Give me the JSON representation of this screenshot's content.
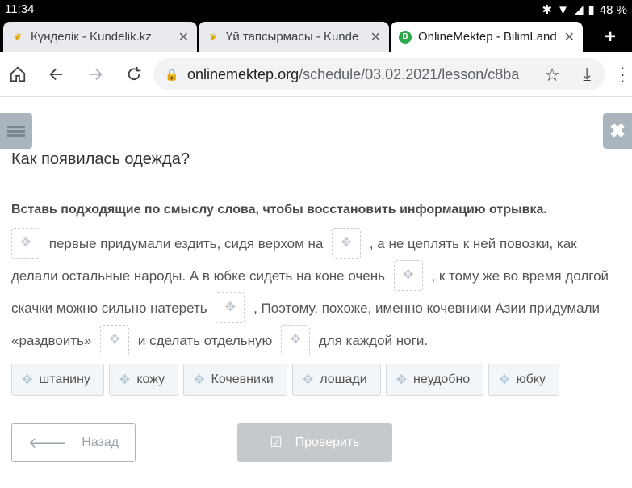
{
  "status_bar": {
    "time": "11:34",
    "battery": "48 %"
  },
  "tabs": [
    {
      "title": "Күнделік - Kundelik.kz",
      "favicon": "kundelik-icon",
      "active": false
    },
    {
      "title": "Үй тапсырмасы - Kunde",
      "favicon": "kundelik-icon",
      "active": false
    },
    {
      "title": "OnlineMektep - BilimLand",
      "favicon": "bilimland-icon",
      "active": true
    }
  ],
  "address_bar": {
    "host": "onlinemektep.org",
    "path": "/schedule/03.02.2021/lesson/c8ba"
  },
  "lesson": {
    "title": "Как появилась одежда?",
    "instruction": "Вставь подходящие по смыслу слова, чтобы восстановить информацию отрывка.",
    "segments": [
      "первые придумали ездить, сидя верхом на",
      ",  а не цеплять к ней повозки, как делали остальные народы. А в юбке сидеть на коне очень",
      ",  к тому же во время долгой скачки можно сильно натереть",
      ",  Поэтому, похоже, именно кочевники Азии придумали «раздвоить»",
      "и сделать отдельную",
      "для каждой ноги."
    ],
    "word_bank": [
      "штанину",
      "кожу",
      "Кочевники",
      "лошади",
      "неудобно",
      "юбку"
    ]
  },
  "buttons": {
    "back_label": "Назад",
    "check_label": "Проверить"
  },
  "colors": {
    "disabled_button": "#c6c9cc",
    "side_button": "#aab5bd"
  }
}
